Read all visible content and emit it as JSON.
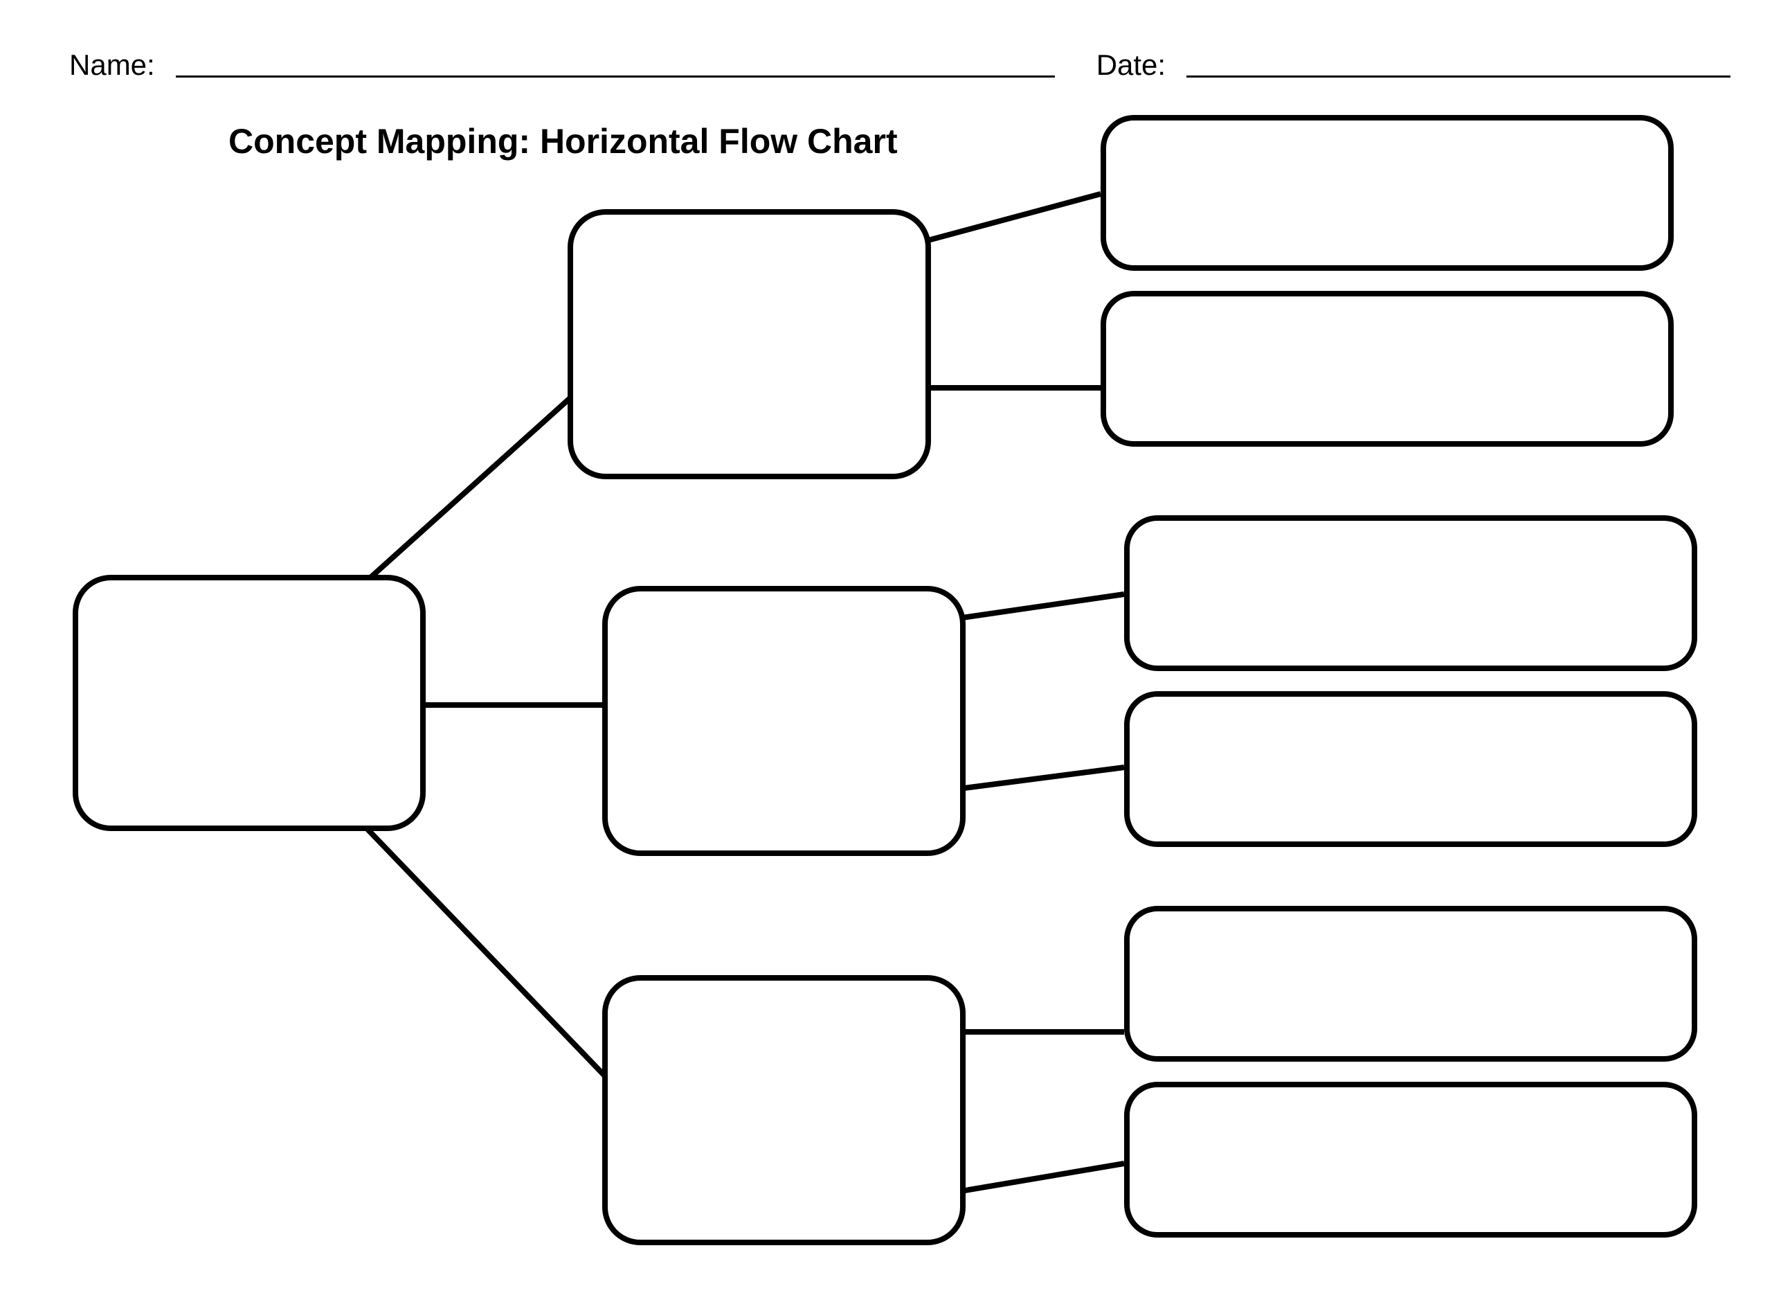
{
  "header": {
    "name_label": "Name:",
    "date_label": "Date:"
  },
  "title": "Concept Mapping: Horizontal Flow Chart",
  "chart_data": {
    "type": "tree",
    "direction": "horizontal",
    "levels": 3,
    "root": {
      "label": "",
      "children": [
        {
          "label": "",
          "children": [
            {
              "label": ""
            },
            {
              "label": ""
            }
          ]
        },
        {
          "label": "",
          "children": [
            {
              "label": ""
            },
            {
              "label": ""
            }
          ]
        },
        {
          "label": "",
          "children": [
            {
              "label": ""
            },
            {
              "label": ""
            }
          ]
        }
      ]
    }
  }
}
